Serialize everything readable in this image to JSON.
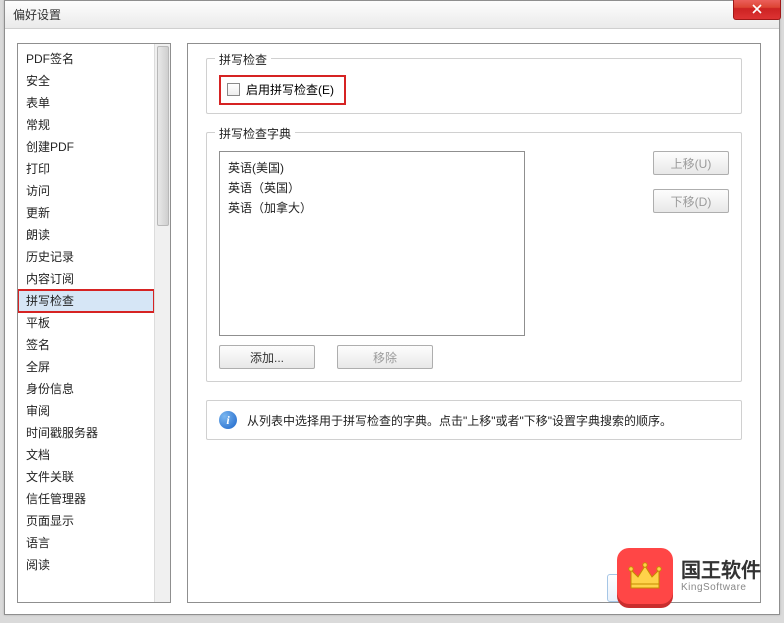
{
  "window": {
    "title": "偏好设置"
  },
  "sidebar": {
    "items": [
      "PDF签名",
      "安全",
      "表单",
      "常规",
      "创建PDF",
      "打印",
      "访问",
      "更新",
      "朗读",
      "历史记录",
      "内容订阅",
      "拼写检查",
      "平板",
      "签名",
      "全屏",
      "身份信息",
      "审阅",
      "时间戳服务器",
      "文档",
      "文件关联",
      "信任管理器",
      "页面显示",
      "语言",
      "阅读"
    ],
    "selected_index": 11
  },
  "group_spellcheck": {
    "label": "拼写检查",
    "enable_label": "启用拼写检查(E)",
    "enable_checked": false
  },
  "group_dict": {
    "label": "拼写检查字典",
    "items": [
      "英语(美国)",
      "英语（英国）",
      "英语（加拿大）"
    ],
    "btn_up": "上移(U)",
    "btn_down": "下移(D)",
    "btn_add": "添加...",
    "btn_remove": "移除"
  },
  "info": {
    "text": "从列表中选择用于拼写检查的字典。点击\"上移\"或者\"下移\"设置字典搜索的顺序。"
  },
  "watermark": {
    "cn": "国王软件",
    "en": "KingSoftware"
  }
}
